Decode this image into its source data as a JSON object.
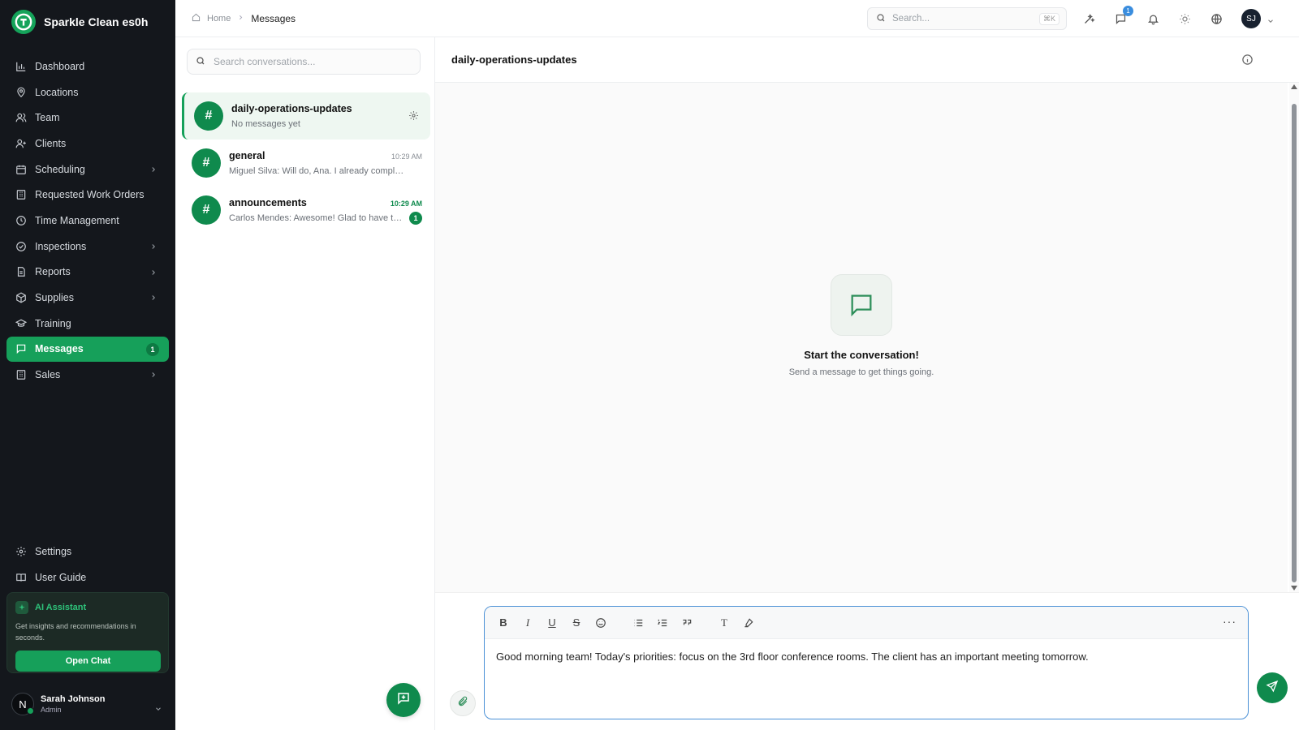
{
  "brand": {
    "name": "Sparkle Clean es0h"
  },
  "nav": {
    "items": [
      {
        "label": "Dashboard",
        "icon": "bar-chart-icon",
        "chevron": false
      },
      {
        "label": "Locations",
        "icon": "map-pin-icon",
        "chevron": false
      },
      {
        "label": "Team",
        "icon": "users-icon",
        "chevron": false
      },
      {
        "label": "Clients",
        "icon": "user-plus-icon",
        "chevron": false
      },
      {
        "label": "Scheduling",
        "icon": "calendar-icon",
        "chevron": true
      },
      {
        "label": "Requested Work Orders",
        "icon": "building-icon",
        "chevron": false
      },
      {
        "label": "Time Management",
        "icon": "clock-icon",
        "chevron": false
      },
      {
        "label": "Inspections",
        "icon": "check-circle-icon",
        "chevron": true
      },
      {
        "label": "Reports",
        "icon": "file-icon",
        "chevron": true
      },
      {
        "label": "Supplies",
        "icon": "package-icon",
        "chevron": true
      },
      {
        "label": "Training",
        "icon": "graduation-cap-icon",
        "chevron": false
      },
      {
        "label": "Messages",
        "icon": "message-square-icon",
        "chevron": false,
        "active": true,
        "badge": "1"
      },
      {
        "label": "Sales",
        "icon": "building-icon",
        "chevron": true
      }
    ],
    "bottom": [
      {
        "label": "Settings",
        "icon": "gear-icon"
      },
      {
        "label": "User Guide",
        "icon": "book-icon"
      }
    ]
  },
  "ai_assistant": {
    "title": "AI Assistant",
    "description": "Get insights and recommendations in seconds.",
    "button": "Open Chat"
  },
  "user": {
    "initial": "N",
    "name": "Sarah Johnson",
    "role": "Admin"
  },
  "topbar": {
    "breadcrumb_home": "Home",
    "breadcrumb_current": "Messages",
    "search_placeholder": "Search...",
    "search_shortcut": "⌘K",
    "messages_badge": "1",
    "avatar_initials": "SJ"
  },
  "conversations": {
    "search_placeholder": "Search conversations...",
    "items": [
      {
        "symbol": "#",
        "name": "daily-operations-updates",
        "preview": "No messages yet",
        "time": "",
        "active": true
      },
      {
        "symbol": "#",
        "name": "general",
        "preview": "Miguel Silva: Will do, Ana. I already complet...",
        "time": "10:29 AM"
      },
      {
        "symbol": "#",
        "name": "announcements",
        "preview": "Carlos Mendes: Awesome! Glad to have thi...",
        "time": "10:29 AM",
        "unread": "1"
      }
    ]
  },
  "chat": {
    "title": "daily-operations-updates",
    "empty_title": "Start the conversation!",
    "empty_subtitle": "Send a message to get things going.",
    "composer_text": "Good morning team! Today's priorities: focus on the 3rd floor conference rooms. The client has an important meeting tomorrow.",
    "toolbar": {
      "bold": "B",
      "italic": "I",
      "underline": "U",
      "strike": "S",
      "text_style": "T",
      "more": "···"
    }
  },
  "colors": {
    "sidebar_bg": "#14171c",
    "accent_green": "#16a05a",
    "channel_green": "#0f8a4d",
    "editor_border": "#4a90d6"
  }
}
